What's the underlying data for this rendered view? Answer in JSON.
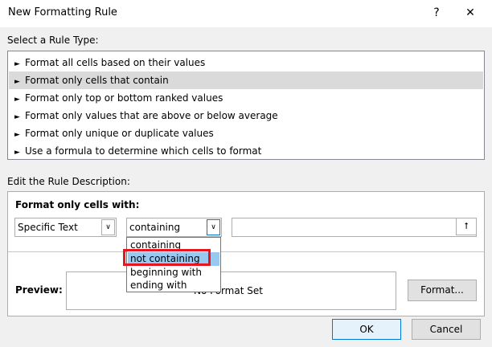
{
  "dialog": {
    "title": "New Formatting Rule",
    "help_glyph": "?",
    "close_glyph": "✕"
  },
  "rule_type": {
    "label": "Select a Rule Type:",
    "arrow_glyph": "►",
    "items": [
      {
        "label": "Format all cells based on their values"
      },
      {
        "label": "Format only cells that contain"
      },
      {
        "label": "Format only top or bottom ranked values"
      },
      {
        "label": "Format only values that are above or below average"
      },
      {
        "label": "Format only unique or duplicate values"
      },
      {
        "label": "Use a formula to determine which cells to format"
      }
    ],
    "selected_index": 1
  },
  "description": {
    "label": "Edit the Rule Description:",
    "heading": "Format only cells with:",
    "condition_type": "Specific Text",
    "operator_value": "containing",
    "operator_options": [
      {
        "label": "containing"
      },
      {
        "label": "not containing"
      },
      {
        "label": "beginning with"
      },
      {
        "label": "ending with"
      }
    ],
    "highlighted_option": 1,
    "value_text": "",
    "dropdown_glyph": "∨",
    "upload_glyph": "⭡"
  },
  "preview": {
    "label": "Preview:",
    "text": "No Format Set",
    "format_button": "Format..."
  },
  "buttons": {
    "ok": "OK",
    "cancel": "Cancel"
  },
  "colors": {
    "highlight_box": "#e8141e",
    "option_highlight": "#99c8f0",
    "ok_border": "#0078d7"
  }
}
